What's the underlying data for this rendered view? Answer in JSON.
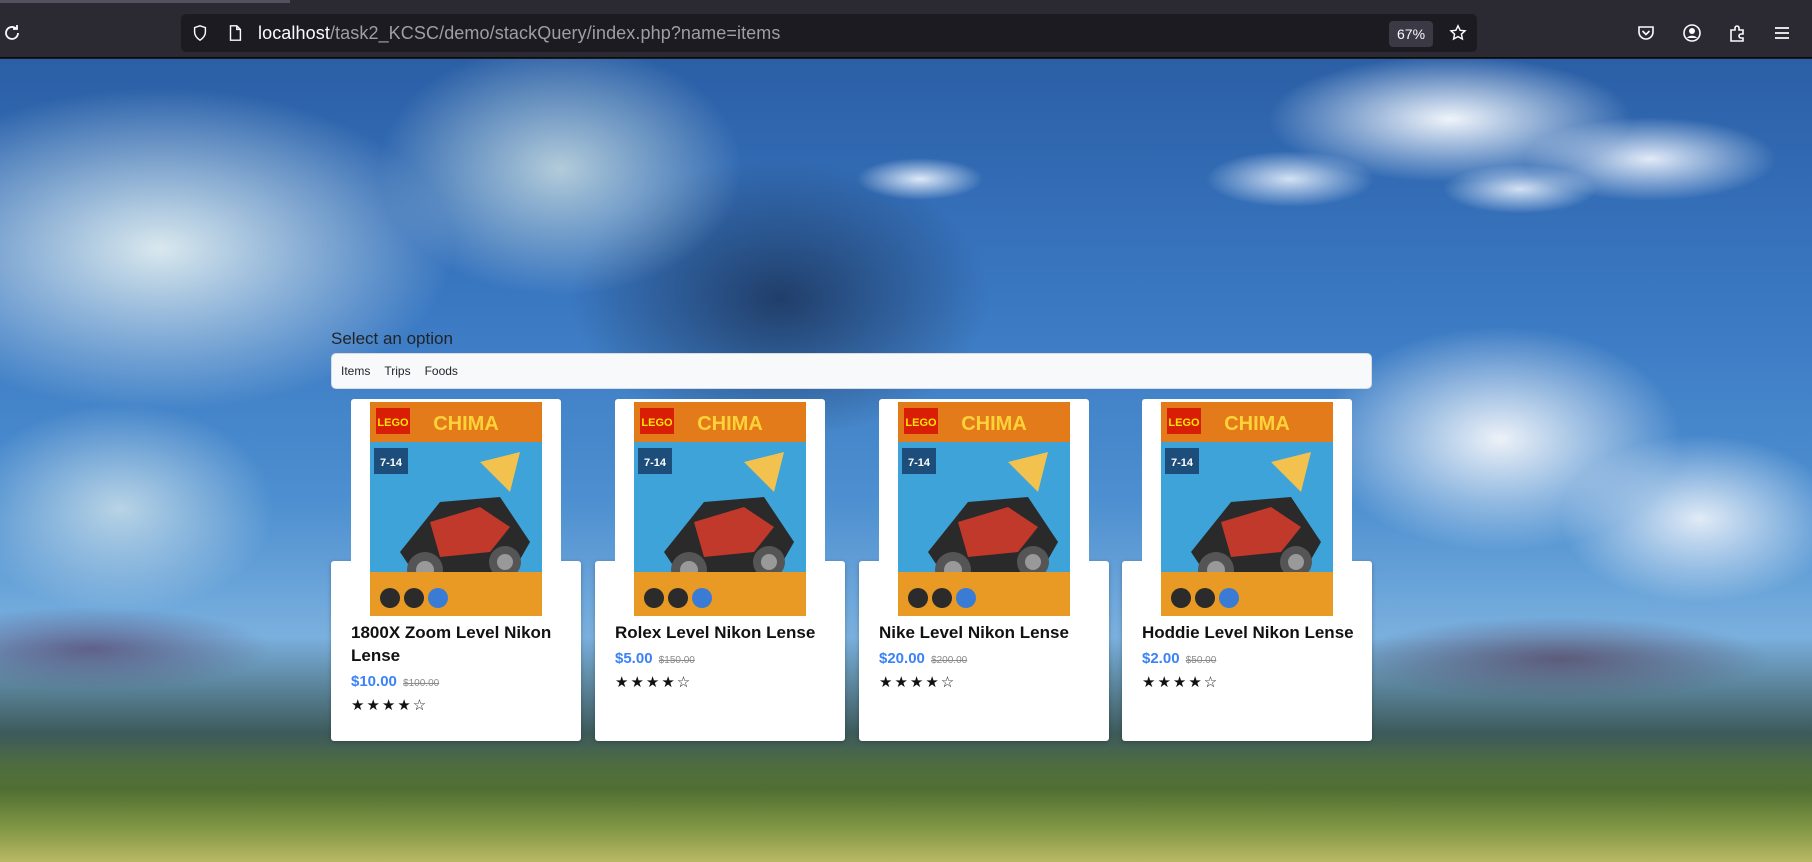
{
  "browser": {
    "url_host": "localhost",
    "url_path": "/task2_KCSC/demo/stackQuery/index.php?name=items",
    "zoom": "67%",
    "icons": [
      "reload-icon",
      "shield-icon",
      "page-icon",
      "star-icon",
      "pocket-icon",
      "account-icon",
      "extensions-icon",
      "menu-icon"
    ]
  },
  "page": {
    "select_label": "Select an option",
    "options": [
      "Items",
      "Trips",
      "Foods"
    ]
  },
  "products": [
    {
      "title": "1800X Zoom Level Nikon Lense",
      "price": "$10.00",
      "old_price": "$100.00",
      "rating": 4,
      "max_rating": 5,
      "image": "lego-chima-box"
    },
    {
      "title": "Rolex Level Nikon Lense",
      "price": "$5.00",
      "old_price": "$150.00",
      "rating": 4,
      "max_rating": 5,
      "image": "lego-chima-box"
    },
    {
      "title": "Nike Level Nikon Lense",
      "price": "$20.00",
      "old_price": "$200.00",
      "rating": 4,
      "max_rating": 5,
      "image": "lego-chima-box"
    },
    {
      "title": "Hoddie Level Nikon Lense",
      "price": "$2.00",
      "old_price": "$50.00",
      "rating": 4,
      "max_rating": 5,
      "image": "lego-chima-box"
    }
  ],
  "colors": {
    "price": "#3b82f6",
    "toolbar": "#2b2a33",
    "urlbar": "#1c1b22"
  }
}
